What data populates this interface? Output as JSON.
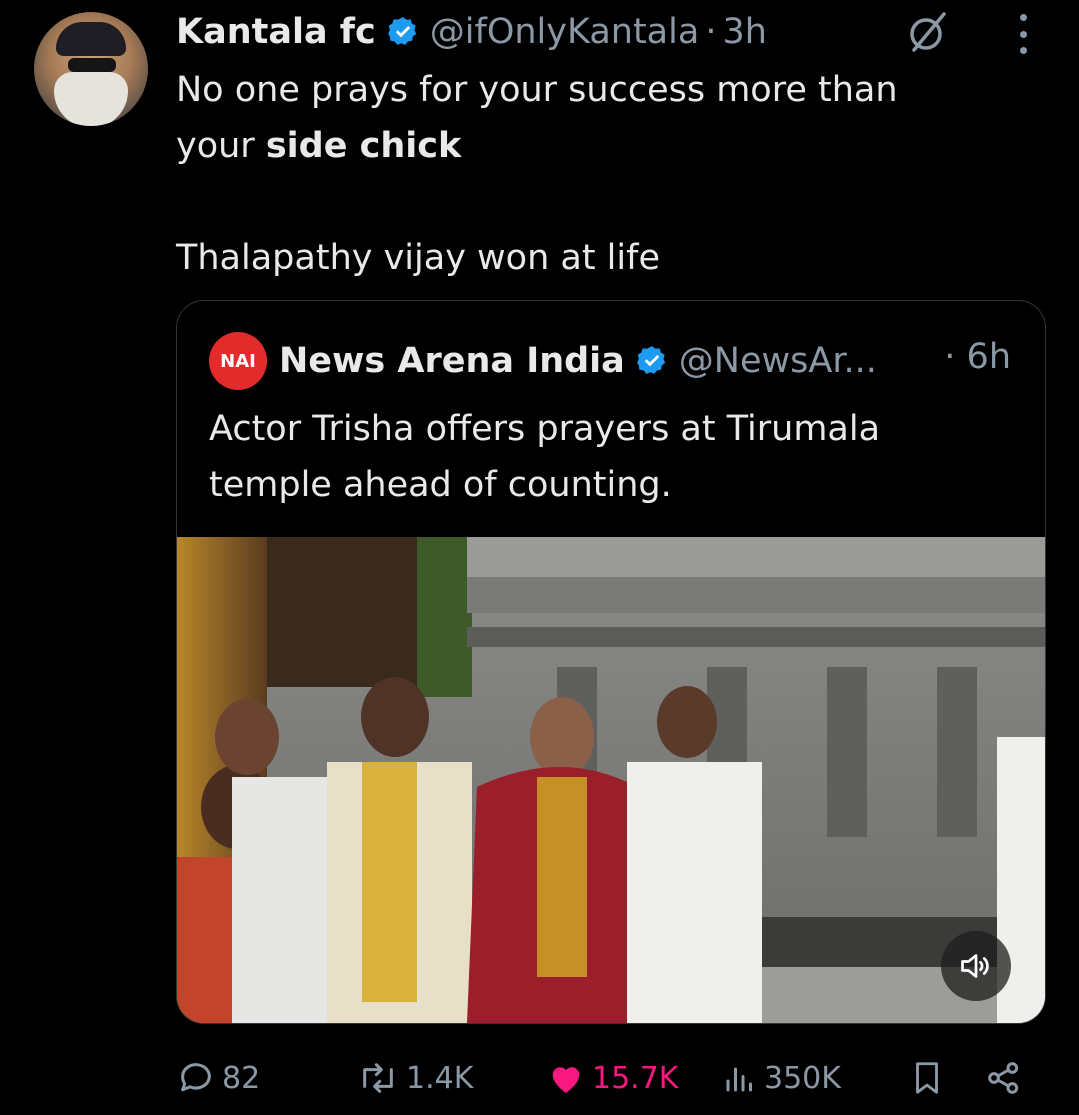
{
  "tweet": {
    "author_name": "Kantala fc",
    "author_handle": "@ifOnlyKantala",
    "separator": "·",
    "time": "3h",
    "text_line1": "No one prays for your success more than",
    "text_line2_prefix": "your ",
    "text_line2_bold": "side chick",
    "text_line3": "Thalapathy vijay won at life"
  },
  "quote": {
    "logo_text": "NAI",
    "author_name": "News Arena India",
    "author_handle": "@NewsAr...",
    "time": "· 6h",
    "text": "Actor Trisha offers prayers at Tirumala temple ahead of counting."
  },
  "actions": {
    "replies": "82",
    "reposts": "1.4K",
    "likes": "15.7K",
    "views": "350K"
  },
  "colors": {
    "background": "#000000",
    "text": "#e7e9ea",
    "muted": "#8b98a5",
    "verified": "#1d9bf0",
    "like": "#f91880",
    "border": "#333639"
  },
  "icons": [
    "verified-badge-icon",
    "grok-icon",
    "more-icon",
    "reply-icon",
    "repost-icon",
    "heart-icon",
    "views-icon",
    "bookmark-icon",
    "share-icon",
    "speaker-icon"
  ]
}
